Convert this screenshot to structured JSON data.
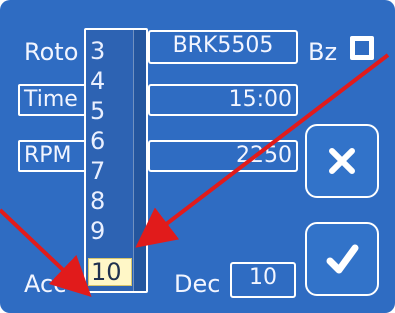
{
  "labels": {
    "rotor": "Roto",
    "time": "Time",
    "rpm": "RPM",
    "acc": "Acc",
    "dec": "Dec",
    "bz": "Bz"
  },
  "fields": {
    "rotor_value": "BRK5505",
    "time_value": "15:00",
    "rpm_value": "2250",
    "dec_value": "10"
  },
  "dropdown": {
    "items": [
      "3",
      "4",
      "5",
      "6",
      "7",
      "8",
      "9",
      "10"
    ],
    "selected": "10"
  },
  "checkbox": {
    "checked": true
  },
  "buttons": {
    "cancel_icon": "x-icon",
    "confirm_icon": "checkmark-icon"
  },
  "colors": {
    "panel": "#2f6cc2",
    "arrow": "#e11b1b",
    "selected_item": "#fff7c7"
  }
}
